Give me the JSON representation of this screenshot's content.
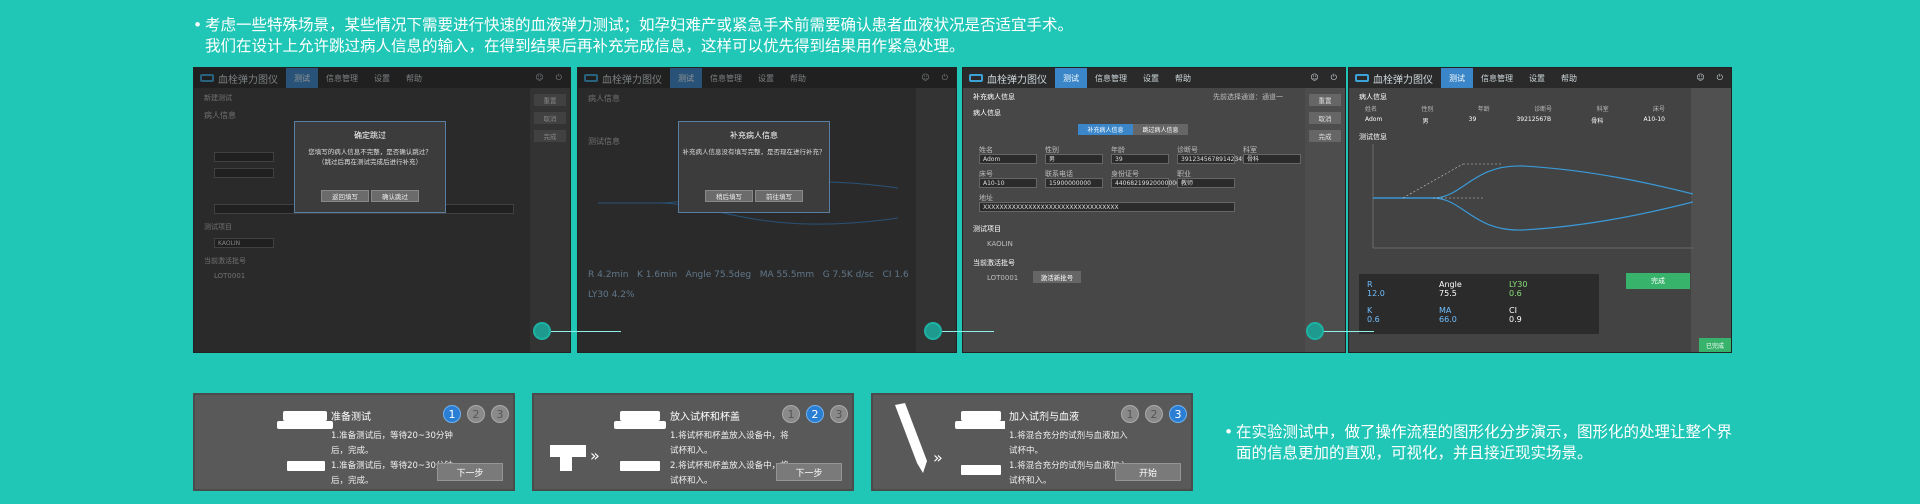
{
  "notes": {
    "top": [
      "考虑一些特殊场景，某些情况下需要进行快速的血液弹力测试；如孕妇难产或紧急手术前需要确认患者血液状况是否适宜手术。",
      "我们在设计上允许跳过病人信息的输入，在得到结果后再补充完成信息，这样可以优先得到结果用作紧急处理。"
    ],
    "right": "在实验测试中，做了操作流程的图形化分步演示，图形化的处理让整个界面的信息更加的直观，可视化，并且接近现实场景。"
  },
  "app": {
    "title": "血栓弹力图仪",
    "tabs": [
      "测试",
      "信息管理",
      "设置",
      "帮助"
    ],
    "sidebar": [
      "重置",
      "取消",
      "完成"
    ]
  },
  "screen1": {
    "section_new": "新建测试",
    "section_patient": "病人信息",
    "section_test": "测试项目",
    "test_value": "KAOLIN",
    "section_lot": "当前激活批号",
    "lot_value": "LOT0001",
    "dialog": {
      "title": "确定跳过",
      "msg1": "您填写的病人信息不完整，是否确认跳过？",
      "msg2": "（跳过后再在测试完成后进行补充）",
      "back": "返回填写",
      "confirm": "确认跳过"
    }
  },
  "screen2": {
    "section_patient": "病人信息",
    "section_test": "测试信息",
    "dialog": {
      "title": "补充病人信息",
      "msg": "补充病人信息没有填写完整，是否现在进行补充？",
      "later": "稍后填写",
      "go": "前往填写"
    },
    "readouts": [
      "R 4.2min",
      "K 1.6min",
      "Angle 75.5deg",
      "MA 55.5mm",
      "G 7.5K d/sc",
      "CI 1.6",
      "LY30 4.2%"
    ]
  },
  "screen3": {
    "title": "补充病人信息",
    "section_patient": "病人信息",
    "tab_a": "补充病人信息",
    "tab_b": "跳过病人信息",
    "labels": [
      "姓名",
      "性别",
      "年龄",
      "诊断号",
      "科室",
      "床号",
      "联系电话",
      "身份证号",
      "职业",
      "地址"
    ],
    "values": [
      "Adom",
      "男",
      "39",
      "39123456789142345",
      "骨科",
      "A10-10",
      "15900000000",
      "440682199200000000",
      "教师",
      "XXXXXXXXXXXXXXXXXXXXXXXXXXXXXXXXX"
    ],
    "section_test": "测试项目",
    "test_value": "KAOLIN",
    "section_lot": "当前激活批号",
    "lot_value": "LOT0001",
    "lot_button": "激活新批号",
    "top_right": "先前选择通道：通道一"
  },
  "screen4": {
    "section_patient": "病人信息",
    "cols": [
      "姓名",
      "性别",
      "年龄",
      "诊断号",
      "科室",
      "床号"
    ],
    "vals": [
      "Adom",
      "男",
      "39",
      "39212567B",
      "骨科",
      "A10-10"
    ],
    "section_test": "测试信息",
    "results": [
      {
        "label": "R",
        "value": "12.0"
      },
      {
        "label": "Angle",
        "value": "75.5"
      },
      {
        "label": "LY30",
        "value": "0.6"
      },
      {
        "label": "K",
        "value": "0.6"
      },
      {
        "label": "MA",
        "value": "66.0"
      },
      {
        "label": "CI",
        "value": "0.9"
      }
    ],
    "done_button": "完成",
    "corner": "已完成"
  },
  "cards": [
    {
      "title": "准备测试",
      "steps": [
        "1",
        "2",
        "3"
      ],
      "active": 0,
      "desc": [
        "1.准备测试后，等待20~30分钟",
        "后，完成。",
        "1.准备测试后，等待20~30分钟",
        "后，完成。"
      ],
      "button": "下一步"
    },
    {
      "title": "放入试杯和杯盖",
      "steps": [
        "1",
        "2",
        "3"
      ],
      "active": 1,
      "desc": [
        "1.将试杯和杯盖放入设备中，将",
        "试杯和入。",
        "2.将试杯和杯盖放入设备中，将",
        "试杯和入。"
      ],
      "button": "下一步"
    },
    {
      "title": "加入试剂与血液",
      "steps": [
        "1",
        "2",
        "3"
      ],
      "active": 2,
      "desc": [
        "1.将混合充分的试剂与血液加入",
        "试杯中。",
        "1.将混合充分的试剂与血液加入",
        "试杯和入。"
      ],
      "button": "开始"
    }
  ],
  "colors": {
    "background": "#21c7b6",
    "accent": "#3a86c8",
    "green": "#37b36b"
  }
}
